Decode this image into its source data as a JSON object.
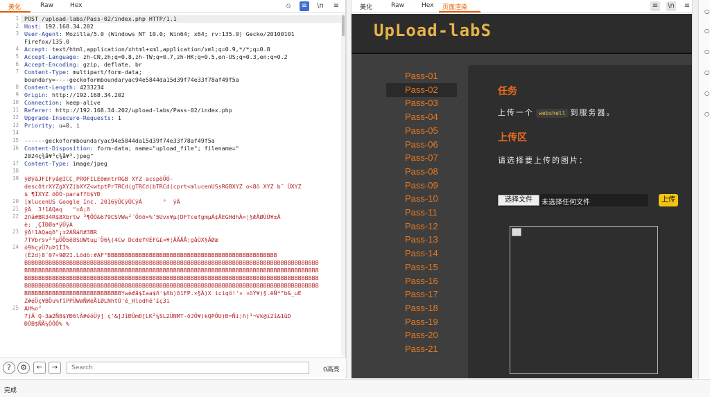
{
  "left_tabs": [
    "美化",
    "Raw",
    "Hex"
  ],
  "left_tool_icons": [
    "eye-off-icon",
    "wrap-icon",
    "newline-icon",
    "menu-icon"
  ],
  "request_lines": [
    {
      "n": "1",
      "k": "",
      "v": "POST /upload-labs/Pass-02/index.php HTTP/1.1"
    },
    {
      "n": "2",
      "k": "Host:",
      "v": " 192.168.34.202"
    },
    {
      "n": "3",
      "k": "User-Agent:",
      "v": " Mozilla/5.0 (Windows NT 10.0; Win64; x64; rv:135.0) Gecko/20100101"
    },
    {
      "n": "",
      "k": "",
      "v": "Firefox/135.0"
    },
    {
      "n": "4",
      "k": "Accept:",
      "v": " text/html,application/xhtml+xml,application/xml;q=0.9,*/*;q=0.8"
    },
    {
      "n": "5",
      "k": "Accept-Language:",
      "v": " zh-CN,zh;q=0.8,zh-TW;q=0.7,zh-HK;q=0.5,en-US;q=0.3,en;q=0.2"
    },
    {
      "n": "6",
      "k": "Accept-Encoding:",
      "v": " gzip, deflate, br"
    },
    {
      "n": "7",
      "k": "Content-Type:",
      "v": " multipart/form-data;"
    },
    {
      "n": "",
      "k": "",
      "v": "boundary=----geckoformboundaryac94e5844da15d39f74e33f78af49f5a"
    },
    {
      "n": "8",
      "k": "Content-Length:",
      "v": " 4233234"
    },
    {
      "n": "9",
      "k": "Origin:",
      "v": " http://192.168.34.202"
    },
    {
      "n": "10",
      "k": "Connection:",
      "v": " keep-alive"
    },
    {
      "n": "11",
      "k": "Referer:",
      "v": " http://192.168.34.202/upload-labs/Pass-02/index.php"
    },
    {
      "n": "12",
      "k": "Upgrade-Insecure-Requests:",
      "v": " 1"
    },
    {
      "n": "13",
      "k": "Priority:",
      "v": " u=0, i"
    },
    {
      "n": "14",
      "k": "",
      "v": ""
    },
    {
      "n": "15",
      "k": "",
      "v": "------geckoformboundaryac94e5844da15d39f74e33f78af49f5a"
    },
    {
      "n": "16",
      "k": "Content-Disposition:",
      "v": " form-data; name=\"upload_file\"; filename=\""
    },
    {
      "n": "",
      "k": "",
      "v": "2024ç¾å¥³ç¾å¥³.jpeg\""
    },
    {
      "n": "17",
      "k": "Content-Type:",
      "v": " image/jpeg"
    },
    {
      "n": "18",
      "k": "",
      "v": ""
    },
    {
      "n": "19",
      "k": "",
      "v": "ÿØÿàJFIFÿâ@ICC_PROFILE0mntrRGB XYZ acspöÖÓ-",
      "bin": true
    },
    {
      "n": "",
      "k": "",
      "v": "descðtrXYZgXYZ(bXYZ<wtptPrTRCd(gTRCd(bTRCd(cprt<mlucenUSsRGBXYZ o<8ö XYZ b¯ ÜXYZ",
      "bin": true
    },
    {
      "n": "",
      "k": "",
      "v": "$ ¶ÏXYZ öÖÓ-paraffö$YÐ",
      "bin": true
    },
    {
      "n": "20",
      "k": "",
      "v": "[mlucenUS Google Inc. 2016ÿÛCÿÛCÿÀ      °  ÿÄ",
      "bin": true
    },
    {
      "n": "21",
      "k": "",
      "v": "ÿÄ  3!1AQaq   \"±Á¡ð",
      "bin": true
    },
    {
      "n": "22",
      "k": "",
      "v": "2ñá#BR34R$8Xbrtw ³¶ÕÓ&679CSVWw²´Ööö×%'5Uvx¥µ(DFTcefgmµÁ¢ÄEGHdhÂ¤¦§ÆÄØÙÚ¥±Â",
      "bin": true
    },
    {
      "n": "",
      "k": "",
      "v": "è: ¸ÇÍÐØa*ÿÛÿA",
      "bin": true
    },
    {
      "n": "23",
      "k": "",
      "v": "ÿÄ!1AQaqð\"¡±2ÀÑáñ#3BR",
      "bin": true
    },
    {
      "n": "",
      "k": "",
      "v": "7TVbrsv²³µÖÖ5ê8SUWtuµ´Ö6¼(4Cw Dcdef©ÉFG£¤¥¦ÂÃÄÅ¦gåÙX§ÃØæ",
      "bin": true
    },
    {
      "n": "24",
      "k": "",
      "v": "ó9hçyÜ7uÞ1ÌÌ%",
      "bin": true
    },
    {
      "n": "",
      "k": "",
      "v": "(Ê2d)8¨07«9Ø2I.Lõdö:#AF°BBBBBBBBBBBBBBBBBBBBBBBBBBBBBBBBBBBBBBBBBBBBBBBBB",
      "bin": true
    },
    {
      "n": "",
      "k": "",
      "v": "BBBBBBBBBBBBBBBBBBBBBBBBBBBBBBBBBBBBBBBBBBBBBBBBBBBBBBBBBBBBBBBBBBBBBBBBBBBBBBBBBBBBB",
      "bin": true
    },
    {
      "n": "",
      "k": "",
      "v": "BBBBBBBBBBBBBBBBBBBBBBBBBBBBBBBBBBBBBBBBBBBBBBBBBBBBBBBBBBBBBBBBBBBBBBBBBBBBBBBBBBBBB",
      "bin": true
    },
    {
      "n": "",
      "k": "",
      "v": "BBBBBBBBBBBBBBBBBBBBBBBBBBBBBBBBBBBBBBBBBBBBBBBBBBBBBBBBBBBBBBBBBBBBBBBBBBBBBBBBBBBBB",
      "bin": true
    },
    {
      "n": "",
      "k": "",
      "v": "BBBBBBBBBBBBBBBBBBBBBBBBBBBBBBBBBBBBBBBBBBBBBBBBBBBBBBBBBBBBBBBBBBBBBBBBBBBBBBBBBBBBB",
      "bin": true
    },
    {
      "n": "",
      "k": "",
      "v": "BBBBBBBBBBBBBBBBBBBBBBBBBBBBYwè#ã$Iaa$ñ'$ñb)ð1FP.×§Â)X iciqö!'¤ ¤öÝ¥)§.ëÑ*°b&_uE",
      "bin": true
    },
    {
      "n": "",
      "k": "",
      "v": "Z#éÖç¥BÖu%fîPPÜWøÑWëÃ1ØLNhtÙ'é_Hlodhé'£ç3i",
      "bin": true
    },
    {
      "n": "25",
      "k": "",
      "v": "AH%o²",
      "bin": true
    },
    {
      "n": "",
      "k": "",
      "v": "7)Â Q-3æ2Ñ8$YÐ6lÂ#éóÜÿ] ç'&]JîÐÛmÐ[LK²¼SL2ÜNMT-öJÖ¥)kQPÔU)Ð=Ñi¦ñ)¹¬Vk@i2î&1ûD",
      "bin": true
    },
    {
      "n": "",
      "k": "",
      "v": "ÐÒB$ÑÃ¼ÔÔÔ% %",
      "bin": true
    }
  ],
  "search": {
    "placeholder": "Search",
    "matches": "0高亮"
  },
  "right_tabs": [
    "美化",
    "Raw",
    "Hex",
    "页面渲染"
  ],
  "right_tool_icons": [
    "copy-icon",
    "newline-icon",
    "menu-icon"
  ],
  "site": {
    "logo": "UpLoad-labS",
    "menu": [
      "Pass-01",
      "Pass-02",
      "Pass-03",
      "Pass-04",
      "Pass-05",
      "Pass-06",
      "Pass-07",
      "Pass-08",
      "Pass-09",
      "Pass-10",
      "Pass-11",
      "Pass-12",
      "Pass-13",
      "Pass-14",
      "Pass-15",
      "Pass-16",
      "Pass-17",
      "Pass-18",
      "Pass-19",
      "Pass-20",
      "Pass-21"
    ],
    "active_index": 1,
    "task_title": "任务",
    "task_prefix": "上传一个",
    "task_code": "webshell",
    "task_suffix": "到服务器。",
    "upload_title": "上传区",
    "upload_prompt": "请选择要上传的图片：",
    "file_button": "选择文件",
    "file_label": "未选择任何文件",
    "upload_button": "上传"
  },
  "status": "完成",
  "colors": {
    "accent": "#e8600a",
    "menu": "#e87a22",
    "logo": "#e8b448",
    "upload": "#f2c40f"
  }
}
